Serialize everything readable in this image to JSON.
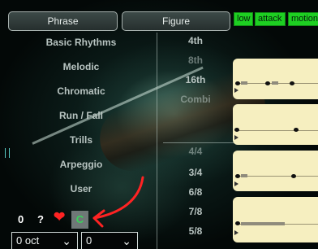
{
  "tabs": {
    "phrase": "Phrase",
    "figure": "Figure"
  },
  "chips": {
    "low": "low",
    "attack": "attack",
    "motion": "motion"
  },
  "phrase_list": [
    "Basic Rhythms",
    "Melodic",
    "Chromatic",
    "Run / Fall",
    "Trills",
    "Arpeggio",
    "User"
  ],
  "figure_list": [
    "4th",
    "8th",
    "16th",
    "Combi",
    "4/4",
    "3/4",
    "6/8",
    "7/8",
    "5/8"
  ],
  "bottom": {
    "zero": "0",
    "question": "?",
    "heart": "❤",
    "c": "C",
    "oct_value": "0 oct",
    "semitone_value": "0",
    "chevron": "⌄"
  },
  "colors": {
    "chip_green": "#1ecf22",
    "staff_bg": "#f6efc0",
    "annotation_arrow": "#ff2323"
  }
}
